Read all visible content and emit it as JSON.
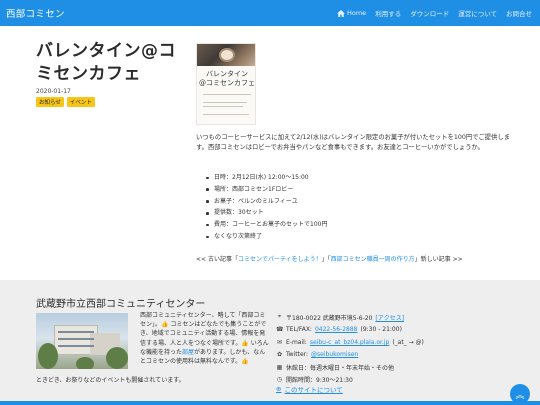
{
  "navbar": {
    "brand": "西部コミセン",
    "items": [
      "Home",
      "利用する",
      "ダウンロード",
      "運営について",
      "お問合せ"
    ]
  },
  "article": {
    "title": "バレンタイン@コミセンカフェ",
    "date": "2020-01-17",
    "tags": [
      "お知らせ",
      "イベント"
    ],
    "poster": {
      "line1": "バレンタイン",
      "line2": "@コミセンカフェ"
    },
    "body": "いつものコーヒーサービスに加えて2/12(水)はバレンタイン限定のお菓子が付いたセットを100円でご提供します。西部コミセンはロビーでお弁当やパンなど食事もできます。お友達とコーヒーいかがでしょうか。",
    "details": [
      "日時：2月12日(水) 12:00～15:00",
      "場所：西部コミセン1Fロビー",
      "お菓子：ペルンのミルフィーユ",
      "提供数：30セット",
      "費用：コーヒーとお菓子のセットで100円",
      "なくなり次第終了"
    ]
  },
  "pager": {
    "prev_label": "<< 古い記事「",
    "prev_link": "コミセンでパーティをしよう！",
    "mid": "」「",
    "next_link": "西部コミセン職員一周の作り方",
    "next_label": "」新しい記事 >>"
  },
  "footer": {
    "org_name": "武蔵野市立西部コミュニティセンター",
    "desc_a": "西部コミュニティセンター、略して「西部コミセン」。",
    "desc_b": " コミセンはどなたでも集うことができ、地域でコミュニティ活動する場、情報を発信する場、人と人をつなぐ場所です。",
    "desc_c": " いろんな機能を持った",
    "desc_link": "部屋",
    "desc_d": "があります。しかも、なんとコミセンの使用料は無料なんです。",
    "tail": "ときどき、お祭りなどのイベントも開催されています。",
    "contact": {
      "address": "〒180-0022 武蔵野市境5-6-20",
      "access_link": "[アクセス]",
      "tel_label": "TEL/FAX: ",
      "tel": "0422-56-2888",
      "tel_hours": " (9:30 - 21:00)",
      "email_label": "E-mail: ",
      "email": "seibu-c_at_bz04.plala.or.jp",
      "email_note": " (_at_ → @)",
      "twitter_label": "Twitter: ",
      "twitter": "@seibukomisen",
      "closed": "休館日：毎週木曜日・年末年始・その他",
      "hours": "開館時間：9:30～21:30"
    },
    "about_link": "このサイトについて"
  }
}
